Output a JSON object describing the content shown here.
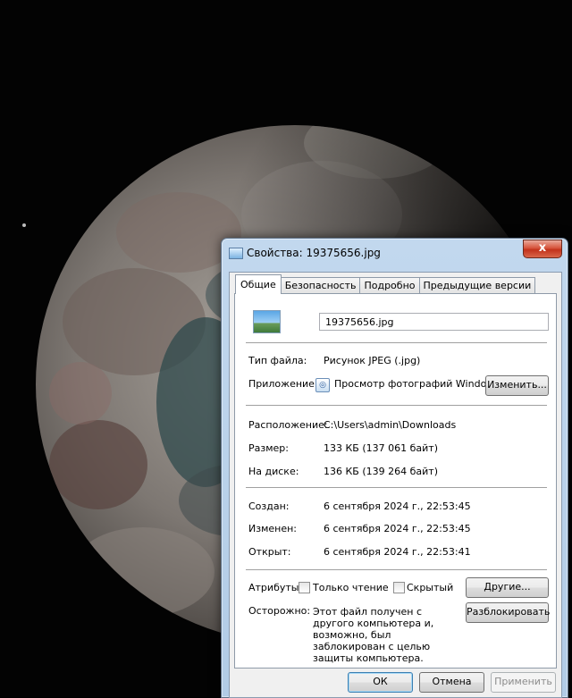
{
  "window": {
    "title": "Свойства: 19375656.jpg",
    "close_glyph": "x"
  },
  "tabs": [
    "Общие",
    "Безопасность",
    "Подробно",
    "Предыдущие версии"
  ],
  "general": {
    "file_name": "19375656.jpg",
    "file_type_label": "Тип файла:",
    "file_type_value": "Рисунок JPEG (.jpg)",
    "app_label": "Приложение:",
    "app_value": "Просмотр фотографий Windows",
    "change_button": "Изменить...",
    "location_label": "Расположение:",
    "location_value": "C:\\Users\\admin\\Downloads",
    "size_label": "Размер:",
    "size_value": "133 КБ (137 061 байт)",
    "disk_label": "На диске:",
    "disk_value": "136 КБ (139 264 байт)",
    "created_label": "Создан:",
    "created_value": "6 сентября 2024 г., 22:53:45",
    "modified_label": "Изменен:",
    "modified_value": "6 сентября 2024 г., 22:53:45",
    "opened_label": "Открыт:",
    "opened_value": "6 сентября 2024 г., 22:53:41",
    "attributes_label": "Атрибуты:",
    "readonly_label": "Только чтение",
    "readonly_checked": false,
    "hidden_label": "Скрытый",
    "hidden_checked": false,
    "other_button": "Другие...",
    "caution_label": "Осторожно:",
    "caution_text": "Этот файл получен с другого компьютера и, возможно, был заблокирован с целью защиты компьютера.",
    "unblock_button": "Разблокировать"
  },
  "footer": {
    "ok": "ОК",
    "cancel": "Отмена",
    "apply": "Применить"
  },
  "background": {
    "description_icon": "moon-photo"
  }
}
